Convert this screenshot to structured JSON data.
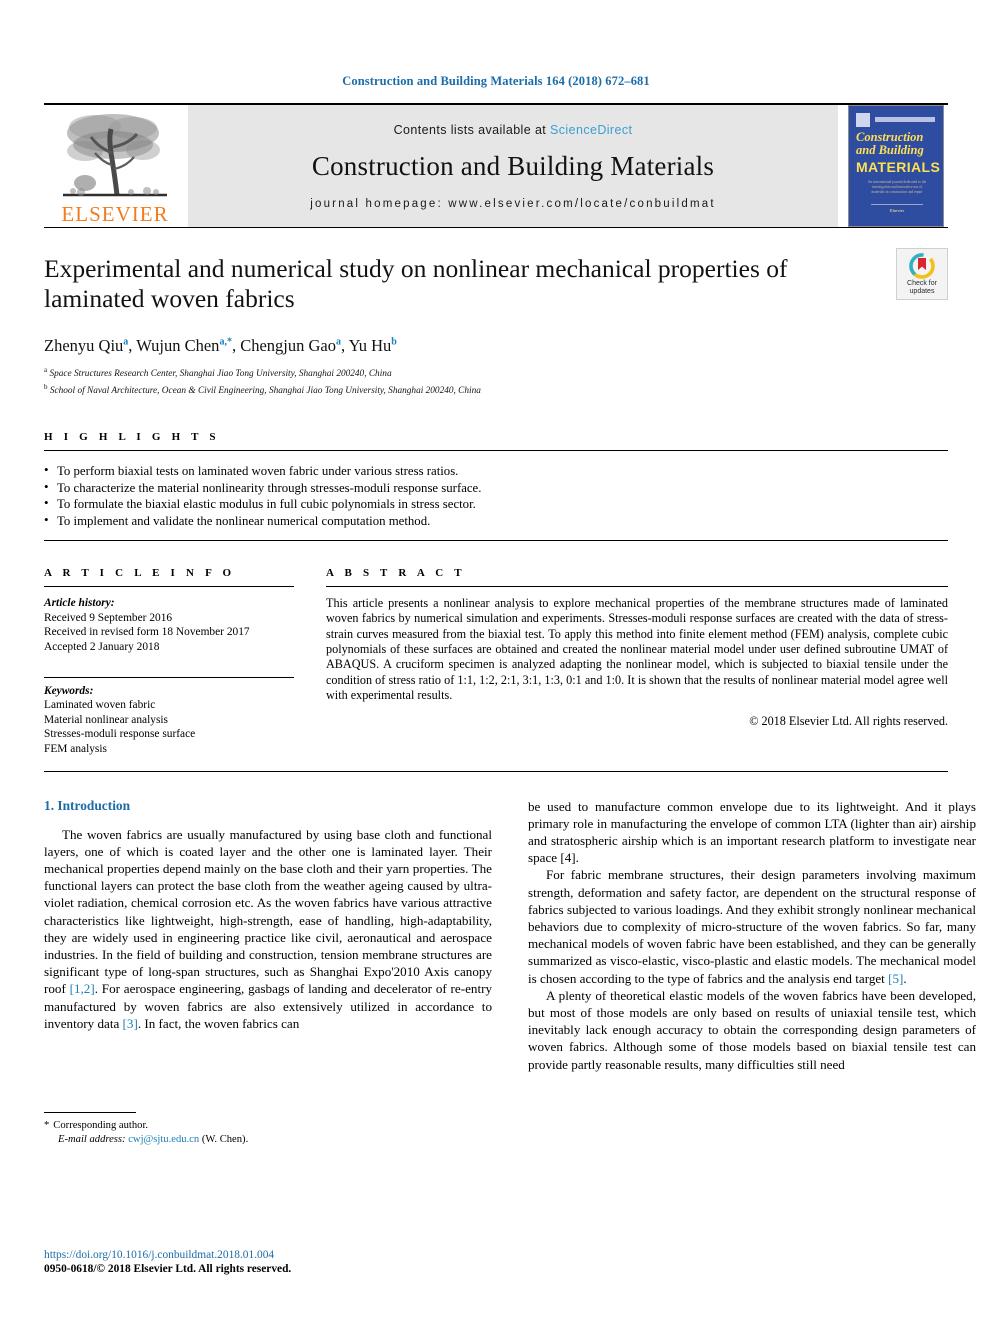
{
  "running_head": "Construction and Building Materials 164 (2018) 672–681",
  "masthead": {
    "publisher_logo_name": "elsevier-tree-logo",
    "publisher_wordmark": "ELSEVIER",
    "contents_prefix": "Contents lists available at ",
    "contents_link": "ScienceDirect",
    "journal_title": "Construction and Building Materials",
    "homepage_label": "journal homepage: www.elsevier.com/locate/conbuildmat",
    "cover": {
      "line1": "Construction",
      "line2": "and Building",
      "line3": "MATERIALS",
      "blurb": "An international journal dedicated to the investigation and innovative use of materials in construction and repair",
      "foot": "Elsevier"
    },
    "colors": {
      "link_blue": "#3c9fd0",
      "elsevier_orange": "#f07c1f",
      "band_gray": "#e6e6e6",
      "cover_blue": "#2f4da0",
      "cover_yellow": "#ffdf55"
    }
  },
  "article": {
    "title": "Experimental and numerical study on nonlinear mechanical properties of laminated woven fabrics",
    "authors": [
      {
        "name": "Zhenyu Qiu",
        "marks": "a"
      },
      {
        "name": "Wujun Chen",
        "marks": "a,*"
      },
      {
        "name": "Chengjun Gao",
        "marks": "a"
      },
      {
        "name": "Yu Hu",
        "marks": "b"
      }
    ],
    "affiliations": [
      {
        "mark": "a",
        "text": "Space Structures Research Center, Shanghai Jiao Tong University, Shanghai 200240, China"
      },
      {
        "mark": "b",
        "text": "School of Naval Architecture, Ocean & Civil Engineering, Shanghai Jiao Tong University, Shanghai 200240, China"
      }
    ],
    "crossmark_label": "Check for\nupdates"
  },
  "highlights": {
    "label": "H I G H L I G H T S",
    "items": [
      "To perform biaxial tests on laminated woven fabric under various stress ratios.",
      "To characterize the material nonlinearity through stresses-moduli response surface.",
      "To formulate the biaxial elastic modulus in full cubic polynomials in stress sector.",
      "To implement and validate the nonlinear numerical computation method."
    ]
  },
  "article_info": {
    "label": "A R T I C L E   I N F O",
    "history_label": "Article history:",
    "history": [
      "Received 9 September 2016",
      "Received in revised form 18 November 2017",
      "Accepted 2 January 2018"
    ],
    "keywords_label": "Keywords:",
    "keywords": [
      "Laminated woven fabric",
      "Material nonlinear analysis",
      "Stresses-moduli response surface",
      "FEM analysis"
    ]
  },
  "abstract": {
    "label": "A B S T R A C T",
    "text": "This article presents a nonlinear analysis to explore mechanical properties of the membrane structures made of laminated woven fabrics by numerical simulation and experiments. Stresses-moduli response surfaces are created with the data of stress-strain curves measured from the biaxial test. To apply this method into finite element method (FEM) analysis, complete cubic polynomials of these surfaces are obtained and created the nonlinear material model under user defined subroutine UMAT of ABAQUS. A cruciform specimen is analyzed adapting the nonlinear model, which is subjected to biaxial tensile under the condition of stress ratio of 1:1, 1:2, 2:1, 3:1, 1:3, 0:1 and 1:0. It is shown that the results of nonlinear material model agree well with experimental results.",
    "copyright": "© 2018 Elsevier Ltd. All rights reserved."
  },
  "body": {
    "section_heading": "1. Introduction",
    "left_paragraphs": [
      "The woven fabrics are usually manufactured by using base cloth and functional layers, one of which is coated layer and the other one is laminated layer. Their mechanical properties depend mainly on the base cloth and their yarn properties. The functional layers can protect the base cloth from the weather ageing caused by ultra-violet radiation, chemical corrosion etc. As the woven fabrics have various attractive characteristics like lightweight, high-strength, ease of handling, high-adaptability, they are widely used in engineering practice like civil, aeronautical and aerospace industries. In the field of building and construction, tension membrane structures are significant type of long-span structures, such as Shanghai Expo'2010 Axis canopy roof [1,2]. For aerospace engineering, gasbags of landing and decelerator of re-entry manufactured by woven fabrics are also extensively utilized in accordance to inventory data [3]. In fact, the woven fabrics can"
    ],
    "right_paragraphs": [
      "be used to manufacture common envelope due to its lightweight. And it plays primary role in manufacturing the envelope of common LTA (lighter than air) airship and stratospheric airship which is an important research platform to investigate near space [4].",
      "For fabric membrane structures, their design parameters involving maximum strength, deformation and safety factor, are dependent on the structural response of fabrics subjected to various loadings. And they exhibit strongly nonlinear mechanical behaviors due to complexity of micro-structure of the woven fabrics. So far, many mechanical models of woven fabric have been established, and they can be generally summarized as visco-elastic, visco-plastic and elastic models. The mechanical model is chosen according to the type of fabrics and the analysis end target [5].",
      "A plenty of theoretical elastic models of the woven fabrics have been developed, but most of those models are only based on results of uniaxial tensile test, which inevitably lack enough accuracy to obtain the corresponding design parameters of woven fabrics. Although some of those models based on biaxial tensile test can provide partly reasonable results, many difficulties still need"
    ],
    "citations": [
      "[1,2]",
      "[3]",
      "[4]",
      "[5]"
    ]
  },
  "footnote": {
    "star": "*",
    "corresponding": "Corresponding author.",
    "email_label": "E-mail address:",
    "email": "cwj@sjtu.edu.cn",
    "email_suffix": "(W. Chen).",
    "doi": "https://doi.org/10.1016/j.conbuildmat.2018.01.004",
    "issn": "0950-0618/© 2018 Elsevier Ltd. All rights reserved."
  }
}
